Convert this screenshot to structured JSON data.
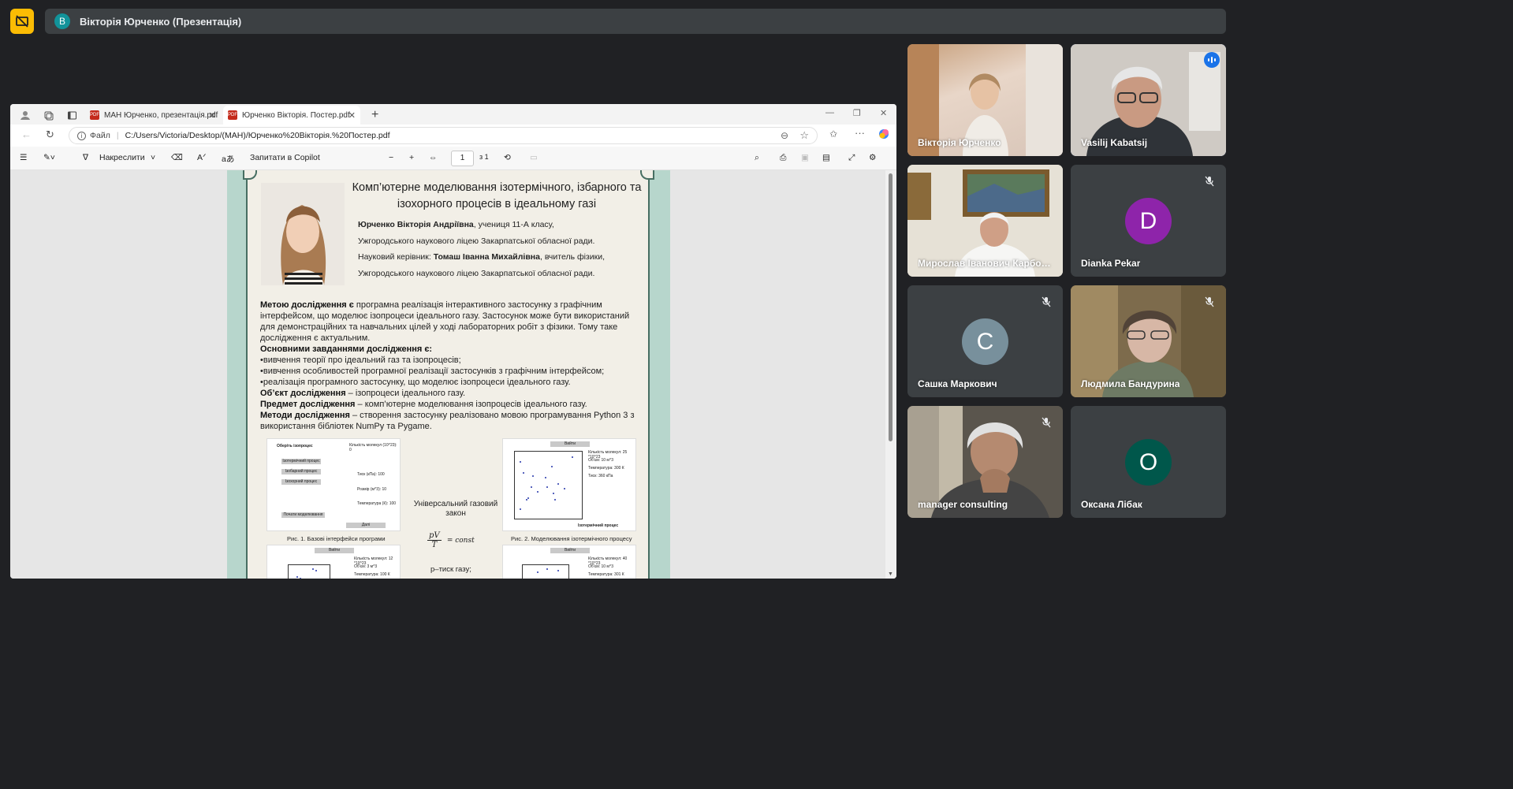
{
  "meet": {
    "presenter_initial": "В",
    "presenter_label": "Вікторія Юрченко (Презентація)"
  },
  "browser": {
    "tabs": [
      {
        "label": "МАН Юрченко, презентація.pdf"
      },
      {
        "label": "Юрченко Вікторія. Постер.pdf"
      }
    ],
    "address_prefix": "Файл",
    "address": "C:/Users/Victoria/Desktop/(МАН)/Юрченко%20Вікторія.%20Постер.pdf"
  },
  "pdf_toolbar": {
    "draw_label": "Накреслити",
    "copilot_label": "Запитати в Copilot",
    "page_current": "1",
    "page_total": "з 1"
  },
  "poster": {
    "title_line1": "Комп’ютерне моделювання ізотермічного, ізбарного та",
    "title_line2": "ізохорного процесів в ідеальному газі",
    "author_name": "Юрченко Вікторія Андріївна",
    "author_rest": ", учениця 11-А класу,",
    "school1": "Ужгородського наукового ліцею Закарпатської обласної ради.",
    "advisor_prefix": "Науковий керівник: ",
    "advisor_name": "Томаш Іванна Михайлівна",
    "advisor_rest": ", вчитель фізики,",
    "school2": "Ужгородського наукового ліцею Закарпатської обласної ради.",
    "goal_label": "Метою дослідження є",
    "goal_text": " програмна реалізація інтерактивного застосунку з графічним інтерфейсом, що моделює ізопроцеси ідеального газу. Застосунок може бути використаний для демонстраційних та навчальних цілей у ході лабораторних робіт з фізики. Тому таке дослідження є актуальним.",
    "tasks_label": "Основними завданнями дослідження є:",
    "task1": "•вивчення теорії про ідеальний газ та ізопроцесів;",
    "task2": "•вивчення особливостей програмної реалізації застосунків з графічним інтерфейсом;",
    "task3": "•реалізація програмного застосунку, що моделює ізопроцеси ідеального газу.",
    "object_label": "Об’єкт дослідження",
    "object_text": " – ізопроцеси ідеального газу.",
    "subject_label": "Предмет дослідження",
    "subject_text": " – комп’ютерне моделювання ізопроцесів ідеального газу.",
    "methods_label": "Методи дослідження",
    "methods_text": " – створення застосунку реалізовано мовою програмування Python 3 з використання бібліотек NumPy та Pygame.",
    "gas_law_label": "Універсальний газовий закон",
    "formula_num": "pV",
    "formula_den": "T",
    "formula_rhs": "= const",
    "pressure_label": "p–тиск газу;",
    "fig1_caption": "Рис. 1. Базові інтерфейси програми",
    "fig2_caption": "Рис. 2. Моделювання ізотермічного процесу",
    "fig1_choose": "Оберіть ізопроцес",
    "fig1_buttons": [
      "Ізотермічний процес",
      "Ізобарний процес",
      "Ізохорний процес"
    ],
    "fig1_start": "Почати моделювання",
    "fig1_next": "Далі",
    "fig1_fields": [
      "Кількість молекул (10^23): 0",
      "Тиск (кПа): 100",
      "Розмір (м^3): 10",
      "Температура (К): 100"
    ],
    "fig_back": "Вийти",
    "fig2_fields": [
      "Кількість молекул: 25 *10^23",
      "Об'єм: 10 м^3",
      "Температура: 300 К",
      "Тиск: 360 кПа"
    ],
    "fig2_process": "Ізотермічний процес",
    "fig3_fields": [
      "Кількість молекул: 12 *10^23",
      "Об'єм: 3 м^3",
      "Температура: 100 К"
    ],
    "fig4_fields": [
      "Кількість молекул: 40 *10^23",
      "Об'єм: 10 м^3",
      "Температура: 301 К"
    ]
  },
  "participants": [
    {
      "name": "Вікторія Юрченко"
    },
    {
      "name": "Vasilij Kabatsij",
      "speaking": true
    },
    {
      "name": "Мирослав Іванович Карбова..."
    },
    {
      "name": "Dianka Pekar",
      "initial": "D",
      "color": "#8e24aa",
      "muted": true
    },
    {
      "name": "Сашка Маркович",
      "initial": "С",
      "color": "#78909c",
      "muted": true
    },
    {
      "name": "Людмила Бандурина",
      "muted": true
    },
    {
      "name": "manager consulting",
      "muted": true
    },
    {
      "name": "Оксана Лібак",
      "initial": "О",
      "color": "#00574b"
    }
  ]
}
